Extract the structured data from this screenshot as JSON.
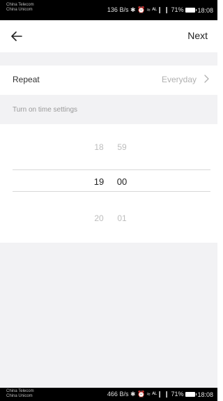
{
  "status_top": {
    "carrier1": "China Telecom",
    "carrier2": "China Unicom",
    "indicators": "136 B/s ✱ ⏰ ≈ ᴬᴸ❙ ❙ 71%",
    "time": "18:08"
  },
  "status_bottom": {
    "carrier1": "China Telecom",
    "carrier2": "China Unicom",
    "indicators": "466 B/s ✱ ⏰ ≈ ᴬᴸ❙ ❙ 71%",
    "time": "18:08"
  },
  "nav": {
    "back_icon": "arrow-left-icon",
    "next_label": "Next"
  },
  "repeat": {
    "label": "Repeat",
    "value": "Everyday",
    "chevron_icon": "chevron-right-icon"
  },
  "section": {
    "title": "Turn on time settings"
  },
  "picker": {
    "hours": [
      "18",
      "19",
      "20"
    ],
    "minutes": [
      "59",
      "00",
      "01"
    ],
    "selected_hour": "19",
    "selected_minute": "00"
  },
  "colors": {
    "background_gray": "#f2f2f4",
    "text_primary": "#222222",
    "text_muted": "#b0b0b0"
  }
}
